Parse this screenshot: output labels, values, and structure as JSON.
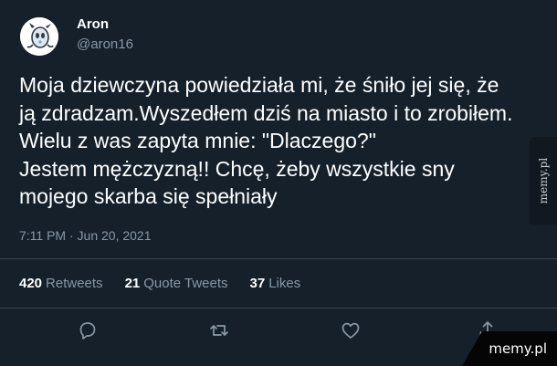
{
  "author": {
    "name": "Aron",
    "handle": "@aron16",
    "avatar_icon": "cartoon-avatar-icon"
  },
  "tweet": {
    "text": "Moja dziewczyna powiedziała mi, że śniło jej się, że\nją zdradzam.Wyszedłem dziś na miasto i to zrobiłem.\nWielu z was zapyta mnie: \"Dlaczego?\"\nJestem mężczyzną!! Chcę, żeby wszystkie sny\nmojego skarba się spełniały",
    "timestamp": "7:11 PM · Jun 20, 2021"
  },
  "stats": {
    "retweets_count": "420",
    "retweets_label": "Retweets",
    "quote_count": "21",
    "quote_label": "Quote Tweets",
    "likes_count": "37",
    "likes_label": "Likes"
  },
  "actions": {
    "reply_icon": "reply-icon",
    "retweet_icon": "retweet-icon",
    "like_icon": "heart-icon",
    "share_icon": "share-icon"
  },
  "watermarks": {
    "side": "memy.pl",
    "corner": "memy.pl"
  },
  "colors": {
    "background": "#15202b",
    "secondary_text": "#8899a6",
    "divider": "#38444d"
  }
}
